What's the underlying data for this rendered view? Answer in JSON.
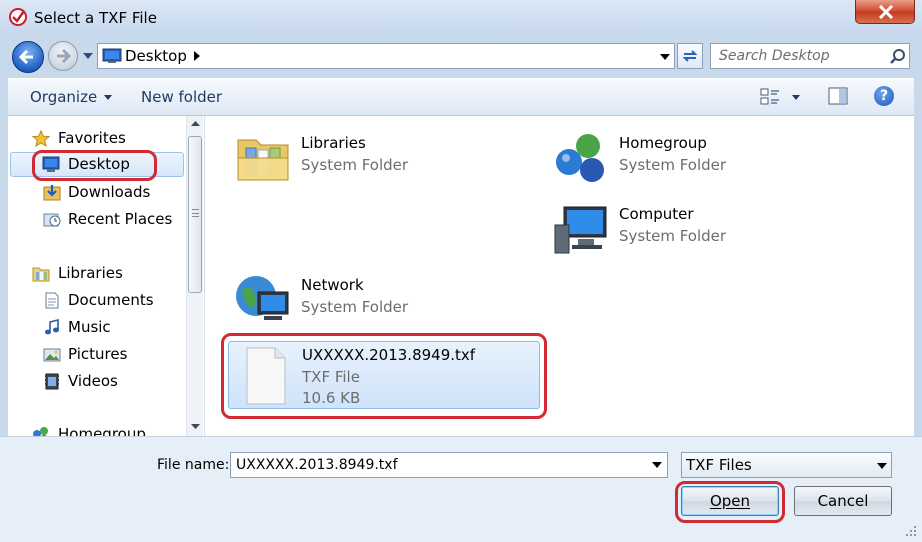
{
  "window": {
    "title": "Select a TXF File"
  },
  "address_bar": {
    "location": "Desktop"
  },
  "search": {
    "placeholder": "Search Desktop"
  },
  "toolbar": {
    "organize_label": "Organize",
    "new_folder_label": "New folder",
    "help_label": "?"
  },
  "nav_pane": {
    "favorites": {
      "label": "Favorites",
      "items": [
        {
          "label": "Desktop",
          "selected": true
        },
        {
          "label": "Downloads"
        },
        {
          "label": "Recent Places"
        }
      ]
    },
    "libraries": {
      "label": "Libraries",
      "items": [
        {
          "label": "Documents"
        },
        {
          "label": "Music"
        },
        {
          "label": "Pictures"
        },
        {
          "label": "Videos"
        }
      ]
    },
    "homegroup": {
      "label": "Homegroup"
    }
  },
  "content": {
    "items": [
      {
        "name": "Libraries",
        "type": "System Folder",
        "icon": "libraries-folder-icon"
      },
      {
        "name": "Homegroup",
        "type": "System Folder",
        "icon": "homegroup-icon"
      },
      {
        "name": "Computer",
        "type": "System Folder",
        "icon": "computer-icon"
      },
      {
        "name": "Network",
        "type": "System Folder",
        "icon": "network-icon"
      },
      {
        "name": "UXXXXX.2013.8949.txf",
        "type": "TXF File",
        "size": "10.6 KB",
        "icon": "document-icon",
        "selected": true
      }
    ]
  },
  "footer": {
    "file_name_label": "File name:",
    "file_name_value": "UXXXXX.2013.8949.txf",
    "file_type_selected": "TXF Files",
    "open_label": "Open",
    "cancel_label": "Cancel"
  },
  "colors": {
    "highlight_red": "#d12a35",
    "selection_blue": "#cfe3fa"
  }
}
